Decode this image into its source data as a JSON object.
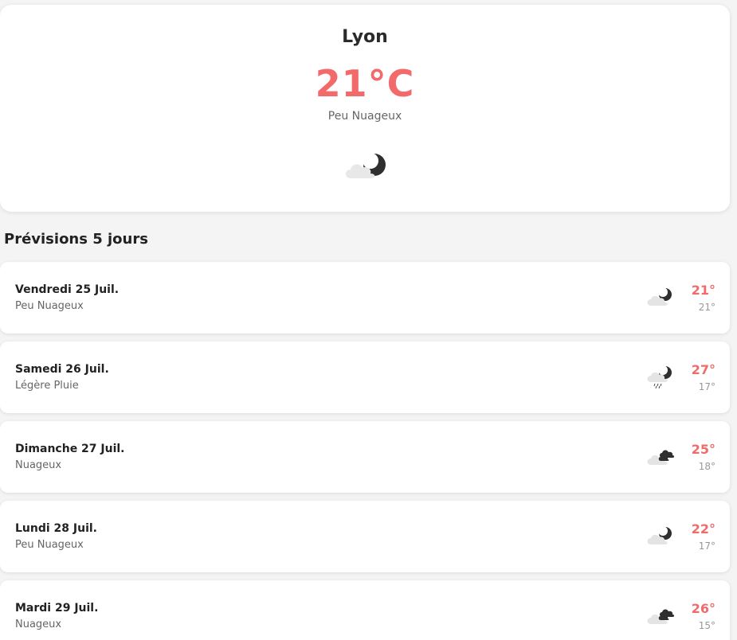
{
  "current": {
    "city": "Lyon",
    "temperature": "21°C",
    "condition": "Peu Nuageux",
    "icon": "partly-cloudy-night-icon"
  },
  "forecast_title": "Prévisions 5 jours",
  "forecast": [
    {
      "day": "Vendredi 25 Juil.",
      "condition": "Peu Nuageux",
      "high": "21°",
      "low": "21°",
      "icon": "partly-cloudy-night-icon"
    },
    {
      "day": "Samedi 26 Juil.",
      "condition": "Légère Pluie",
      "high": "27°",
      "low": "17°",
      "icon": "light-rain-night-icon"
    },
    {
      "day": "Dimanche 27 Juil.",
      "condition": "Nuageux",
      "high": "25°",
      "low": "18°",
      "icon": "cloudy-icon"
    },
    {
      "day": "Lundi 28 Juil.",
      "condition": "Peu Nuageux",
      "high": "22°",
      "low": "17°",
      "icon": "partly-cloudy-night-icon"
    },
    {
      "day": "Mardi 29 Juil.",
      "condition": "Nuageux",
      "high": "26°",
      "low": "15°",
      "icon": "cloudy-icon"
    }
  ],
  "colors": {
    "accent": "#f26a6a",
    "background": "#f4f4f4",
    "card": "#ffffff"
  }
}
